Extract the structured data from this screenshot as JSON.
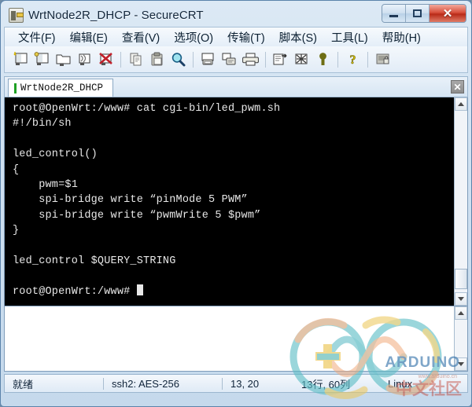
{
  "window": {
    "title": "WrtNode2R_DHCP - SecureCRT",
    "app_icon": "securecrt-icon",
    "minimize_label": "–",
    "maximize_label": "□",
    "close_label": "✕"
  },
  "menubar": {
    "items": [
      {
        "label": "文件(F)",
        "name": "menu-file"
      },
      {
        "label": "编辑(E)",
        "name": "menu-edit"
      },
      {
        "label": "查看(V)",
        "name": "menu-view"
      },
      {
        "label": "选项(O)",
        "name": "menu-options"
      },
      {
        "label": "传输(T)",
        "name": "menu-transfer"
      },
      {
        "label": "脚本(S)",
        "name": "menu-script"
      },
      {
        "label": "工具(L)",
        "name": "menu-tools"
      },
      {
        "label": "帮助(H)",
        "name": "menu-help"
      }
    ]
  },
  "toolbar": {
    "buttons": [
      {
        "name": "new-session-icon",
        "title": "新建会话"
      },
      {
        "name": "clone-session-icon",
        "title": "克隆会话"
      },
      {
        "name": "open-folder-icon",
        "title": "连接"
      },
      {
        "name": "quick-connect-icon",
        "title": "快速连接"
      },
      {
        "name": "disconnect-icon",
        "title": "断开"
      },
      {
        "name": "separator-1",
        "title": ""
      },
      {
        "name": "copy-icon",
        "title": "复制"
      },
      {
        "name": "paste-icon",
        "title": "粘贴"
      },
      {
        "name": "find-icon",
        "title": "查找"
      },
      {
        "name": "separator-2",
        "title": ""
      },
      {
        "name": "print-screen-icon",
        "title": "打印屏幕"
      },
      {
        "name": "log-session-icon",
        "title": "记录会话"
      },
      {
        "name": "print-icon",
        "title": "打印"
      },
      {
        "name": "separator-3",
        "title": ""
      },
      {
        "name": "session-options-icon",
        "title": "会话选项"
      },
      {
        "name": "global-options-icon",
        "title": "全局选项"
      },
      {
        "name": "key-icon",
        "title": "密钥"
      },
      {
        "name": "separator-4",
        "title": ""
      },
      {
        "name": "help-icon",
        "title": "帮助"
      },
      {
        "name": "separator-5",
        "title": ""
      },
      {
        "name": "lock-screen-icon",
        "title": "锁定"
      }
    ]
  },
  "tabs": {
    "items": [
      {
        "label": "WrtNode2R_DHCP",
        "active": true
      }
    ],
    "close_label": "✕"
  },
  "terminal": {
    "lines": [
      "root@OpenWrt:/www# cat cgi-bin/led_pwm.sh",
      "#!/bin/sh",
      "",
      "led_control()",
      "{",
      "    pwm=$1",
      "    spi-bridge write “pinMode 5 PWM”",
      "    spi-bridge write “pwmWrite 5 $pwm”",
      "}",
      "",
      "led_control $QUERY_STRING",
      "",
      "root@OpenWrt:/www# "
    ],
    "foreground": "#e8e8e8",
    "background": "#000000"
  },
  "statusbar": {
    "ready": "就绪",
    "encryption": "ssh2: AES-256",
    "position": "13, 20",
    "size": "13行, 60列",
    "emulation": "Linux"
  },
  "watermark": {
    "brand": "ARDUINO",
    "community": "中文社区",
    "subtext": "www.arduino.cn",
    "logo": "arduino-infinity-logo"
  }
}
